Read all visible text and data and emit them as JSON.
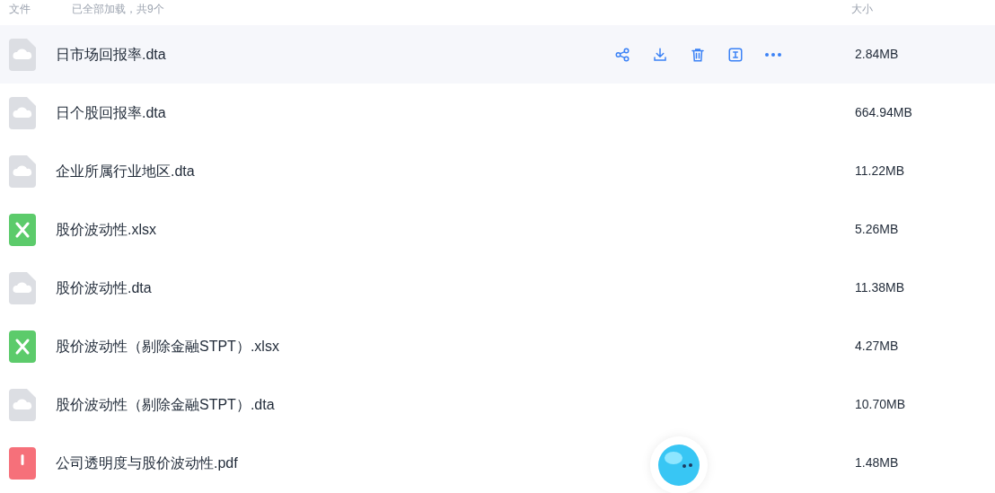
{
  "header": {
    "name_column": "文件",
    "status": "已全部加载，共9个",
    "size_column": "大小"
  },
  "files": [
    {
      "name": "日市场回报率.dta",
      "size": "2.84MB",
      "kind": "dta",
      "hovered": true
    },
    {
      "name": "日个股回报率.dta",
      "size": "664.94MB",
      "kind": "dta",
      "hovered": false
    },
    {
      "name": "企业所属行业地区.dta",
      "size": "11.22MB",
      "kind": "dta",
      "hovered": false
    },
    {
      "name": "股价波动性.xlsx",
      "size": "5.26MB",
      "kind": "xlsx",
      "hovered": false
    },
    {
      "name": "股价波动性.dta",
      "size": "11.38MB",
      "kind": "dta",
      "hovered": false
    },
    {
      "name": "股价波动性（剔除金融STPT）.xlsx",
      "size": "4.27MB",
      "kind": "xlsx",
      "hovered": false
    },
    {
      "name": "股价波动性（剔除金融STPT）.dta",
      "size": "10.70MB",
      "kind": "dta",
      "hovered": false
    },
    {
      "name": "公司透明度与股价波动性.pdf",
      "size": "1.48MB",
      "kind": "pdf",
      "hovered": false
    }
  ]
}
